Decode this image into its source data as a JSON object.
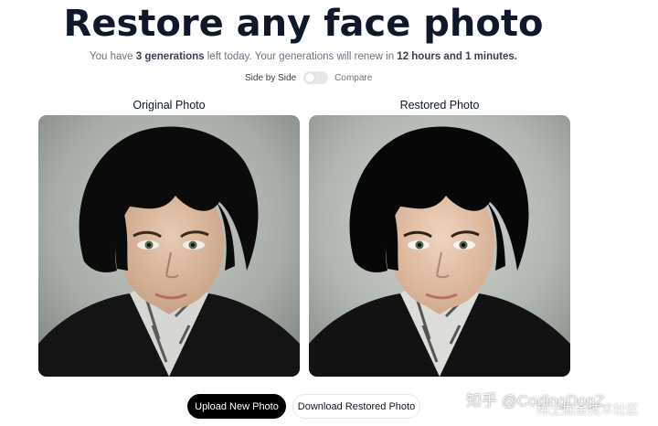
{
  "header": {
    "title": "Restore any face photo",
    "subtitle_prefix": "You have ",
    "generations_count": "3 generations",
    "subtitle_mid": " left today. Your generations will renew in ",
    "renew_time": "12 hours and 1 minutes."
  },
  "view_toggle": {
    "left_label": "Side by Side",
    "right_label": "Compare",
    "is_on": false
  },
  "panels": {
    "original_label": "Original Photo",
    "restored_label": "Restored Photo"
  },
  "actions": {
    "upload_label": "Upload New Photo",
    "download_label": "Download Restored Photo"
  },
  "watermark": {
    "line1": "知乎 @CodingDogZ",
    "line2": "稀土掘金技术社区"
  },
  "colors": {
    "title": "#0f172a",
    "primary_button": "#000000",
    "toggle_off": "#e5e7eb"
  }
}
